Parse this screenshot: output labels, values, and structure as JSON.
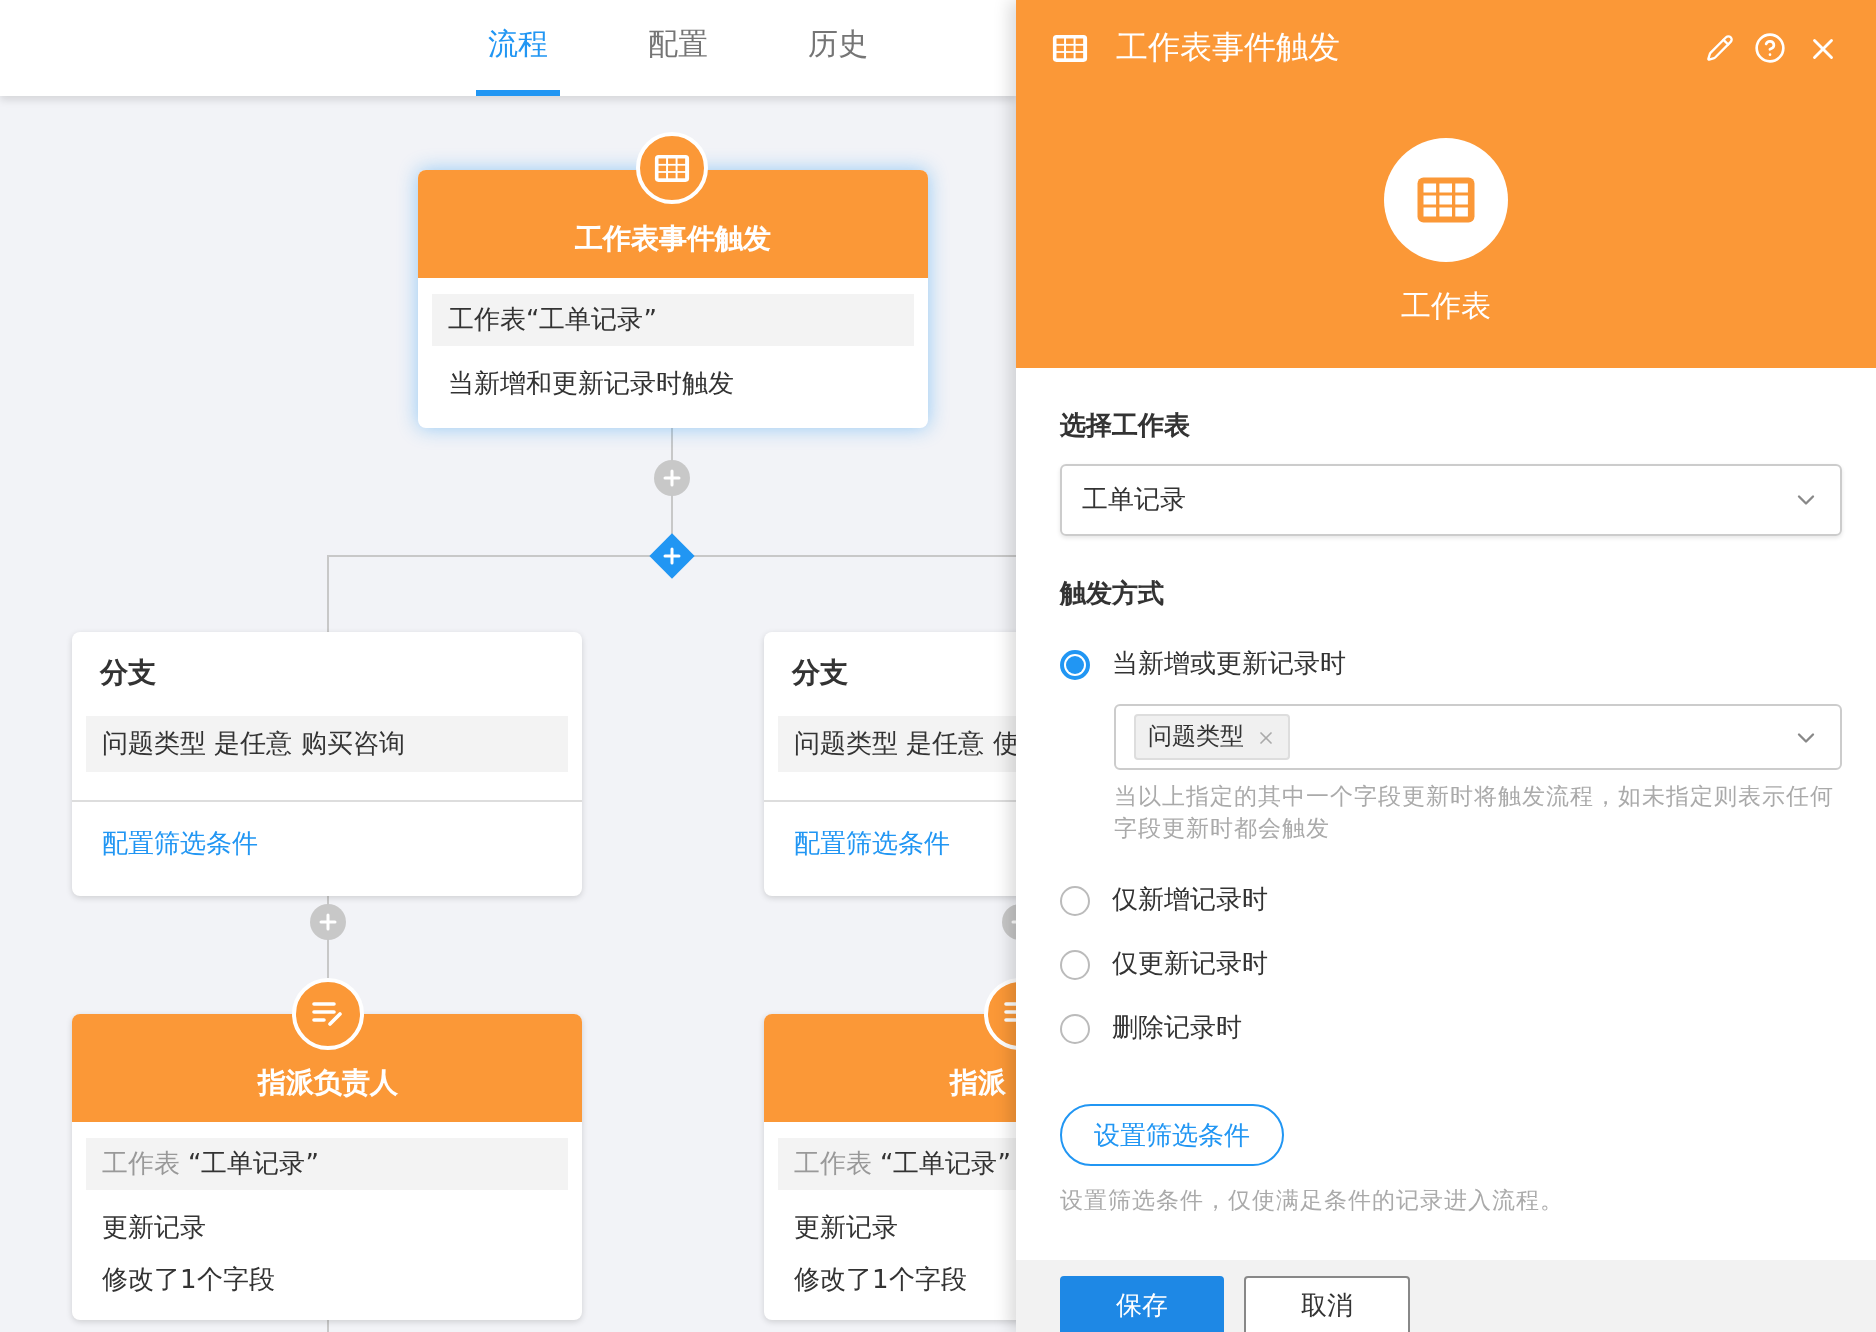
{
  "tabs": [
    {
      "label": "流程",
      "selected": true
    },
    {
      "label": "配置",
      "selected": false
    },
    {
      "label": "历史",
      "selected": false
    }
  ],
  "flow": {
    "trigger": {
      "title": "工作表事件触发",
      "sheet": "工作表“工单记录”",
      "description": "当新增和更新记录时触发"
    },
    "branches": [
      {
        "title": "分支",
        "condition": "问题类型 是任意 购买咨询",
        "link": "配置筛选条件",
        "action": {
          "title": "指派负责人",
          "sheet_label": "工作表",
          "sheet_name": "“工单记录”",
          "lines": [
            "更新记录",
            "修改了1个字段"
          ]
        }
      },
      {
        "title": "分支",
        "condition": "问题类型 是任意 使",
        "link": "配置筛选条件",
        "action": {
          "title": "指派",
          "sheet_label": "工作表",
          "sheet_name": "“工单记录”",
          "lines": [
            "更新记录",
            "修改了1个字段"
          ]
        }
      }
    ]
  },
  "panel": {
    "title": "工作表事件触发",
    "icon_label": "工作表",
    "select_label": "选择工作表",
    "select_value": "工单记录",
    "trigger_label": "触发方式",
    "options": [
      {
        "label": "当新增或更新记录时",
        "selected": true,
        "fields": [
          "问题类型"
        ],
        "hint": "当以上指定的其中一个字段更新时将触发流程，如未指定则表示任何字段更新时都会触发"
      },
      {
        "label": "仅新增记录时",
        "selected": false
      },
      {
        "label": "仅更新记录时",
        "selected": false
      },
      {
        "label": "删除记录时",
        "selected": false
      }
    ],
    "filter_button": "设置筛选条件",
    "filter_hint": "设置筛选条件，仅使满足条件的记录进入流程。",
    "buttons": [
      {
        "label": "保存",
        "kind": "primary"
      },
      {
        "label": "取消",
        "kind": "secondary"
      }
    ]
  }
}
